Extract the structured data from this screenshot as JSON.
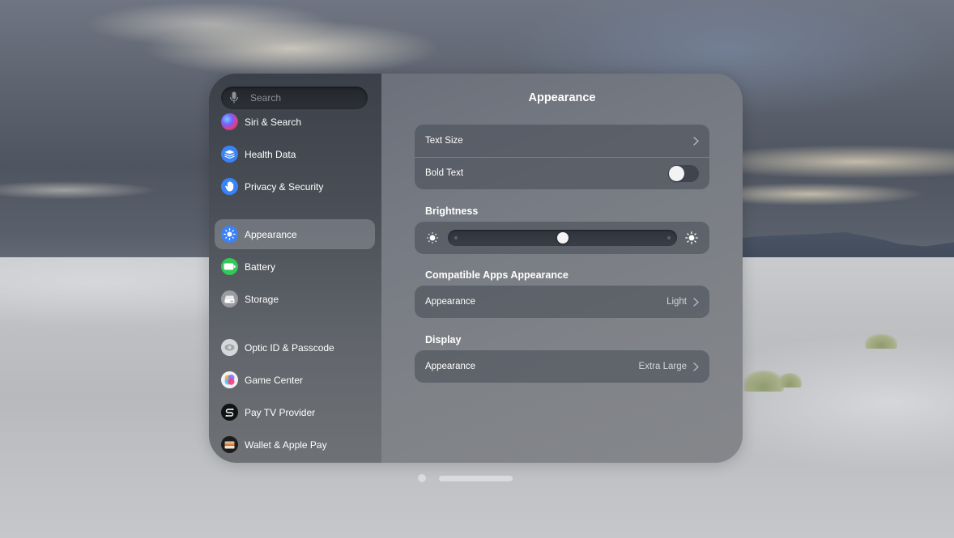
{
  "window": {
    "sidebar": {
      "search": {
        "placeholder": "Search",
        "value": ""
      },
      "items": [
        {
          "id": "siri",
          "label": "Siri & Search",
          "icon": "siri-icon",
          "selected": false
        },
        {
          "id": "health",
          "label": "Health Data",
          "icon": "health-data-icon",
          "selected": false
        },
        {
          "id": "privacy",
          "label": "Privacy & Security",
          "icon": "hand-icon",
          "selected": false
        },
        {
          "id": "appearance",
          "label": "Appearance",
          "icon": "sun-icon",
          "selected": true
        },
        {
          "id": "battery",
          "label": "Battery",
          "icon": "battery-icon",
          "selected": false
        },
        {
          "id": "storage",
          "label": "Storage",
          "icon": "storage-icon",
          "selected": false
        },
        {
          "id": "optic",
          "label": "Optic ID & Passcode",
          "icon": "eye-icon",
          "selected": false
        },
        {
          "id": "gamecenter",
          "label": "Game Center",
          "icon": "game-center-icon",
          "selected": false
        },
        {
          "id": "paytv",
          "label": "Pay TV Provider",
          "icon": "tv-provider-icon",
          "selected": false
        },
        {
          "id": "wallet",
          "label": "Wallet & Apple Pay",
          "icon": "wallet-icon",
          "selected": false
        }
      ]
    },
    "main": {
      "title": "Appearance",
      "text_group": {
        "text_size_label": "Text Size",
        "bold_text_label": "Bold Text",
        "bold_text_on": false
      },
      "brightness": {
        "header": "Brightness",
        "level_percent": 50
      },
      "compatible_apps": {
        "header": "Compatible Apps Appearance",
        "row_label": "Appearance",
        "row_value": "Light"
      },
      "display": {
        "header": "Display",
        "row_label": "Appearance",
        "row_value": "Extra Large"
      }
    }
  },
  "pager": {
    "pages": 2,
    "current": 1
  },
  "colors": {
    "accent_blue": "#3a82f7",
    "battery_green": "#34c759",
    "toggle_off": "#3f444d"
  }
}
